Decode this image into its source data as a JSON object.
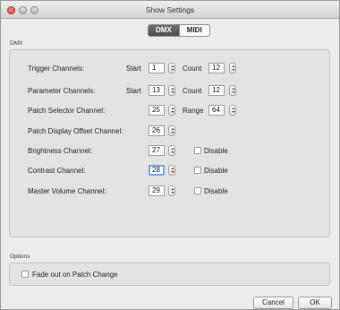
{
  "window": {
    "title": "Show Settings"
  },
  "tabs": {
    "dmx": "DMX",
    "midi": "MIDI"
  },
  "dmx_group": {
    "label": "DMX",
    "rows": {
      "trigger": {
        "label": "Trigger Channels:",
        "start_label": "Start",
        "start": "1",
        "count_label": "Count",
        "count": "12"
      },
      "parameter": {
        "label": "Parameter Channels:",
        "start_label": "Start",
        "start": "13",
        "count_label": "Count",
        "count": "12"
      },
      "patch_selector": {
        "label": "Patch Selector Channel:",
        "value": "25",
        "range_label": "Range",
        "range": "64"
      },
      "patch_display": {
        "label": "Patch Display Offset Channel:",
        "value": "26"
      },
      "brightness": {
        "label": "Brightness Channel:",
        "value": "27",
        "disable_label": "Disable"
      },
      "contrast": {
        "label": "Contrast Channel:",
        "value": "28",
        "disable_label": "Disable"
      },
      "master_volume": {
        "label": "Master Volume Channel:",
        "value": "29",
        "disable_label": "Disable"
      }
    }
  },
  "options_group": {
    "label": "Options",
    "fade_out_label": "Fade out on Patch Change"
  },
  "buttons": {
    "cancel": "Cancel",
    "ok": "OK"
  }
}
